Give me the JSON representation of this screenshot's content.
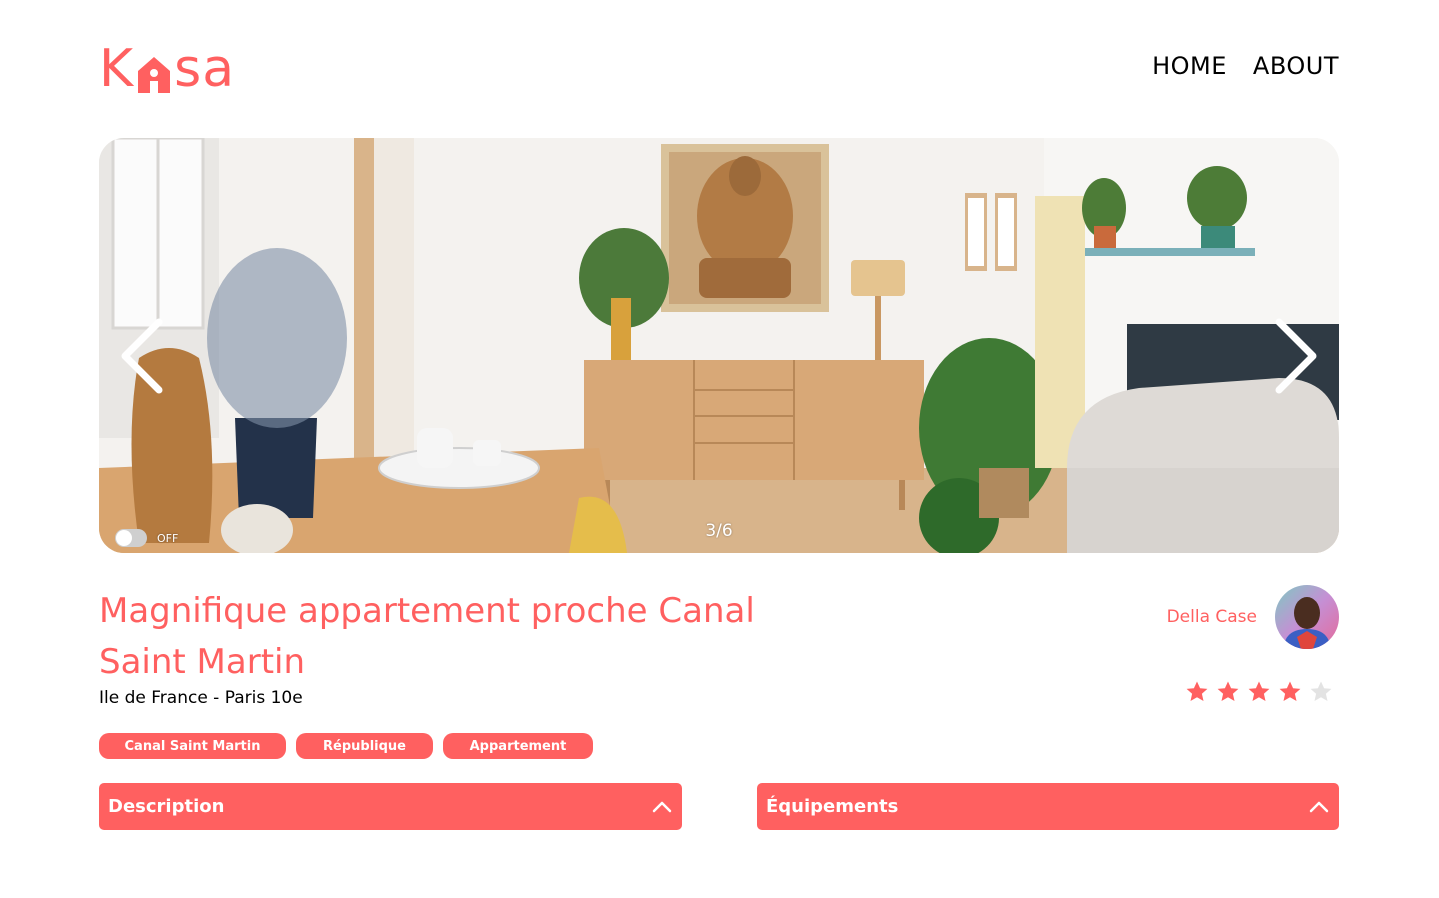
{
  "header": {
    "logo": {
      "parts": [
        "K",
        "sa"
      ]
    },
    "nav": [
      {
        "label": "HOME"
      },
      {
        "label": "ABOUT"
      }
    ]
  },
  "carousel": {
    "counter": "3/6",
    "toggle_label": "OFF",
    "current": 3,
    "total": 6
  },
  "listing": {
    "title": "Magnifique appartement proche Canal Saint Martin",
    "location": "Ile de France - Paris 10e",
    "tags": [
      "Canal Saint Martin",
      "République",
      "Appartement"
    ],
    "host": {
      "name": "Della Case"
    },
    "rating": {
      "value": 4,
      "max": 5
    }
  },
  "collapses": {
    "description": {
      "label": "Description"
    },
    "equipments": {
      "label": "Équipements"
    }
  },
  "colors": {
    "accent": "#FF6060",
    "star_off": "#E3E3E3",
    "text": "#000000"
  },
  "icons": {
    "prev": "chevron-left-icon",
    "next": "chevron-right-icon",
    "collapse": "chevron-up-icon",
    "star": "star-icon"
  }
}
